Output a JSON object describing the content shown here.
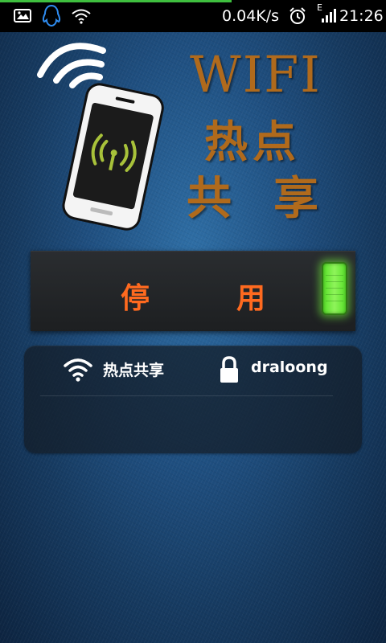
{
  "status_bar": {
    "network_speed": "0.04K/s",
    "time": "21:26",
    "signal_type": "E",
    "icons": [
      "image-icon",
      "qq-penguin-icon",
      "wifi-status-icon",
      "alarm-icon",
      "signal-icon"
    ],
    "progress": 0.6
  },
  "hero": {
    "title_wifi": "WIFI",
    "title_line2": "热点",
    "title_line3": "共享"
  },
  "toggle": {
    "char1": "停",
    "char2": "用",
    "state": "on"
  },
  "info": {
    "ssid_label": "热点共享",
    "password_label": "draloong"
  },
  "colors": {
    "title": "#b06a1c",
    "toggle_text": "#ff6a1f",
    "knob_green": "#6ee83a"
  }
}
